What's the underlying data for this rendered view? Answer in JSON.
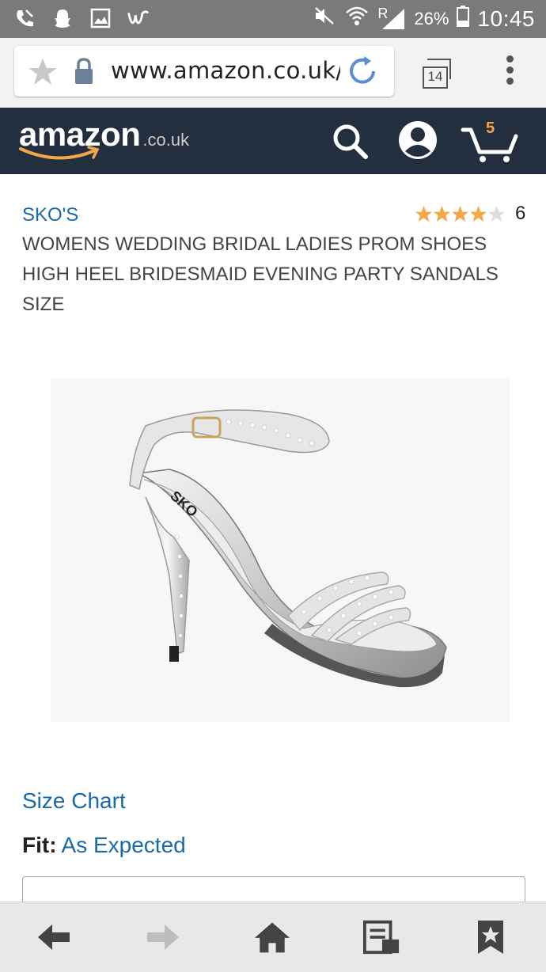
{
  "status_bar": {
    "time": "10:45",
    "battery_percent": "26%",
    "network": "R"
  },
  "browser": {
    "url": "www.amazon.co.uk/",
    "tab_count": "14"
  },
  "header": {
    "logo_text": "amazon",
    "logo_tld": ".co.uk",
    "cart_count": "5"
  },
  "product": {
    "brand": "SKO'S",
    "title": "WOMENS WEDDING BRIDAL LADIES PROM SHOES HIGH HEEL BRIDESMAID EVENING PARTY SANDALS SIZE",
    "rating_stars": 4,
    "rating_max": 5,
    "review_count": "6",
    "image_alt": "Silver diamante high heel platform sandal"
  },
  "size": {
    "size_chart_label": "Size Chart",
    "fit_label": "Fit:",
    "fit_value": "As Expected"
  },
  "colors": {
    "amazon_nav": "#232f3e",
    "link_blue": "#1a6aa5",
    "star_orange": "#f3a847"
  },
  "bottom_nav": {
    "items": [
      "back-icon",
      "forward-icon",
      "home-icon",
      "reading-list-icon",
      "bookmark-icon"
    ]
  }
}
